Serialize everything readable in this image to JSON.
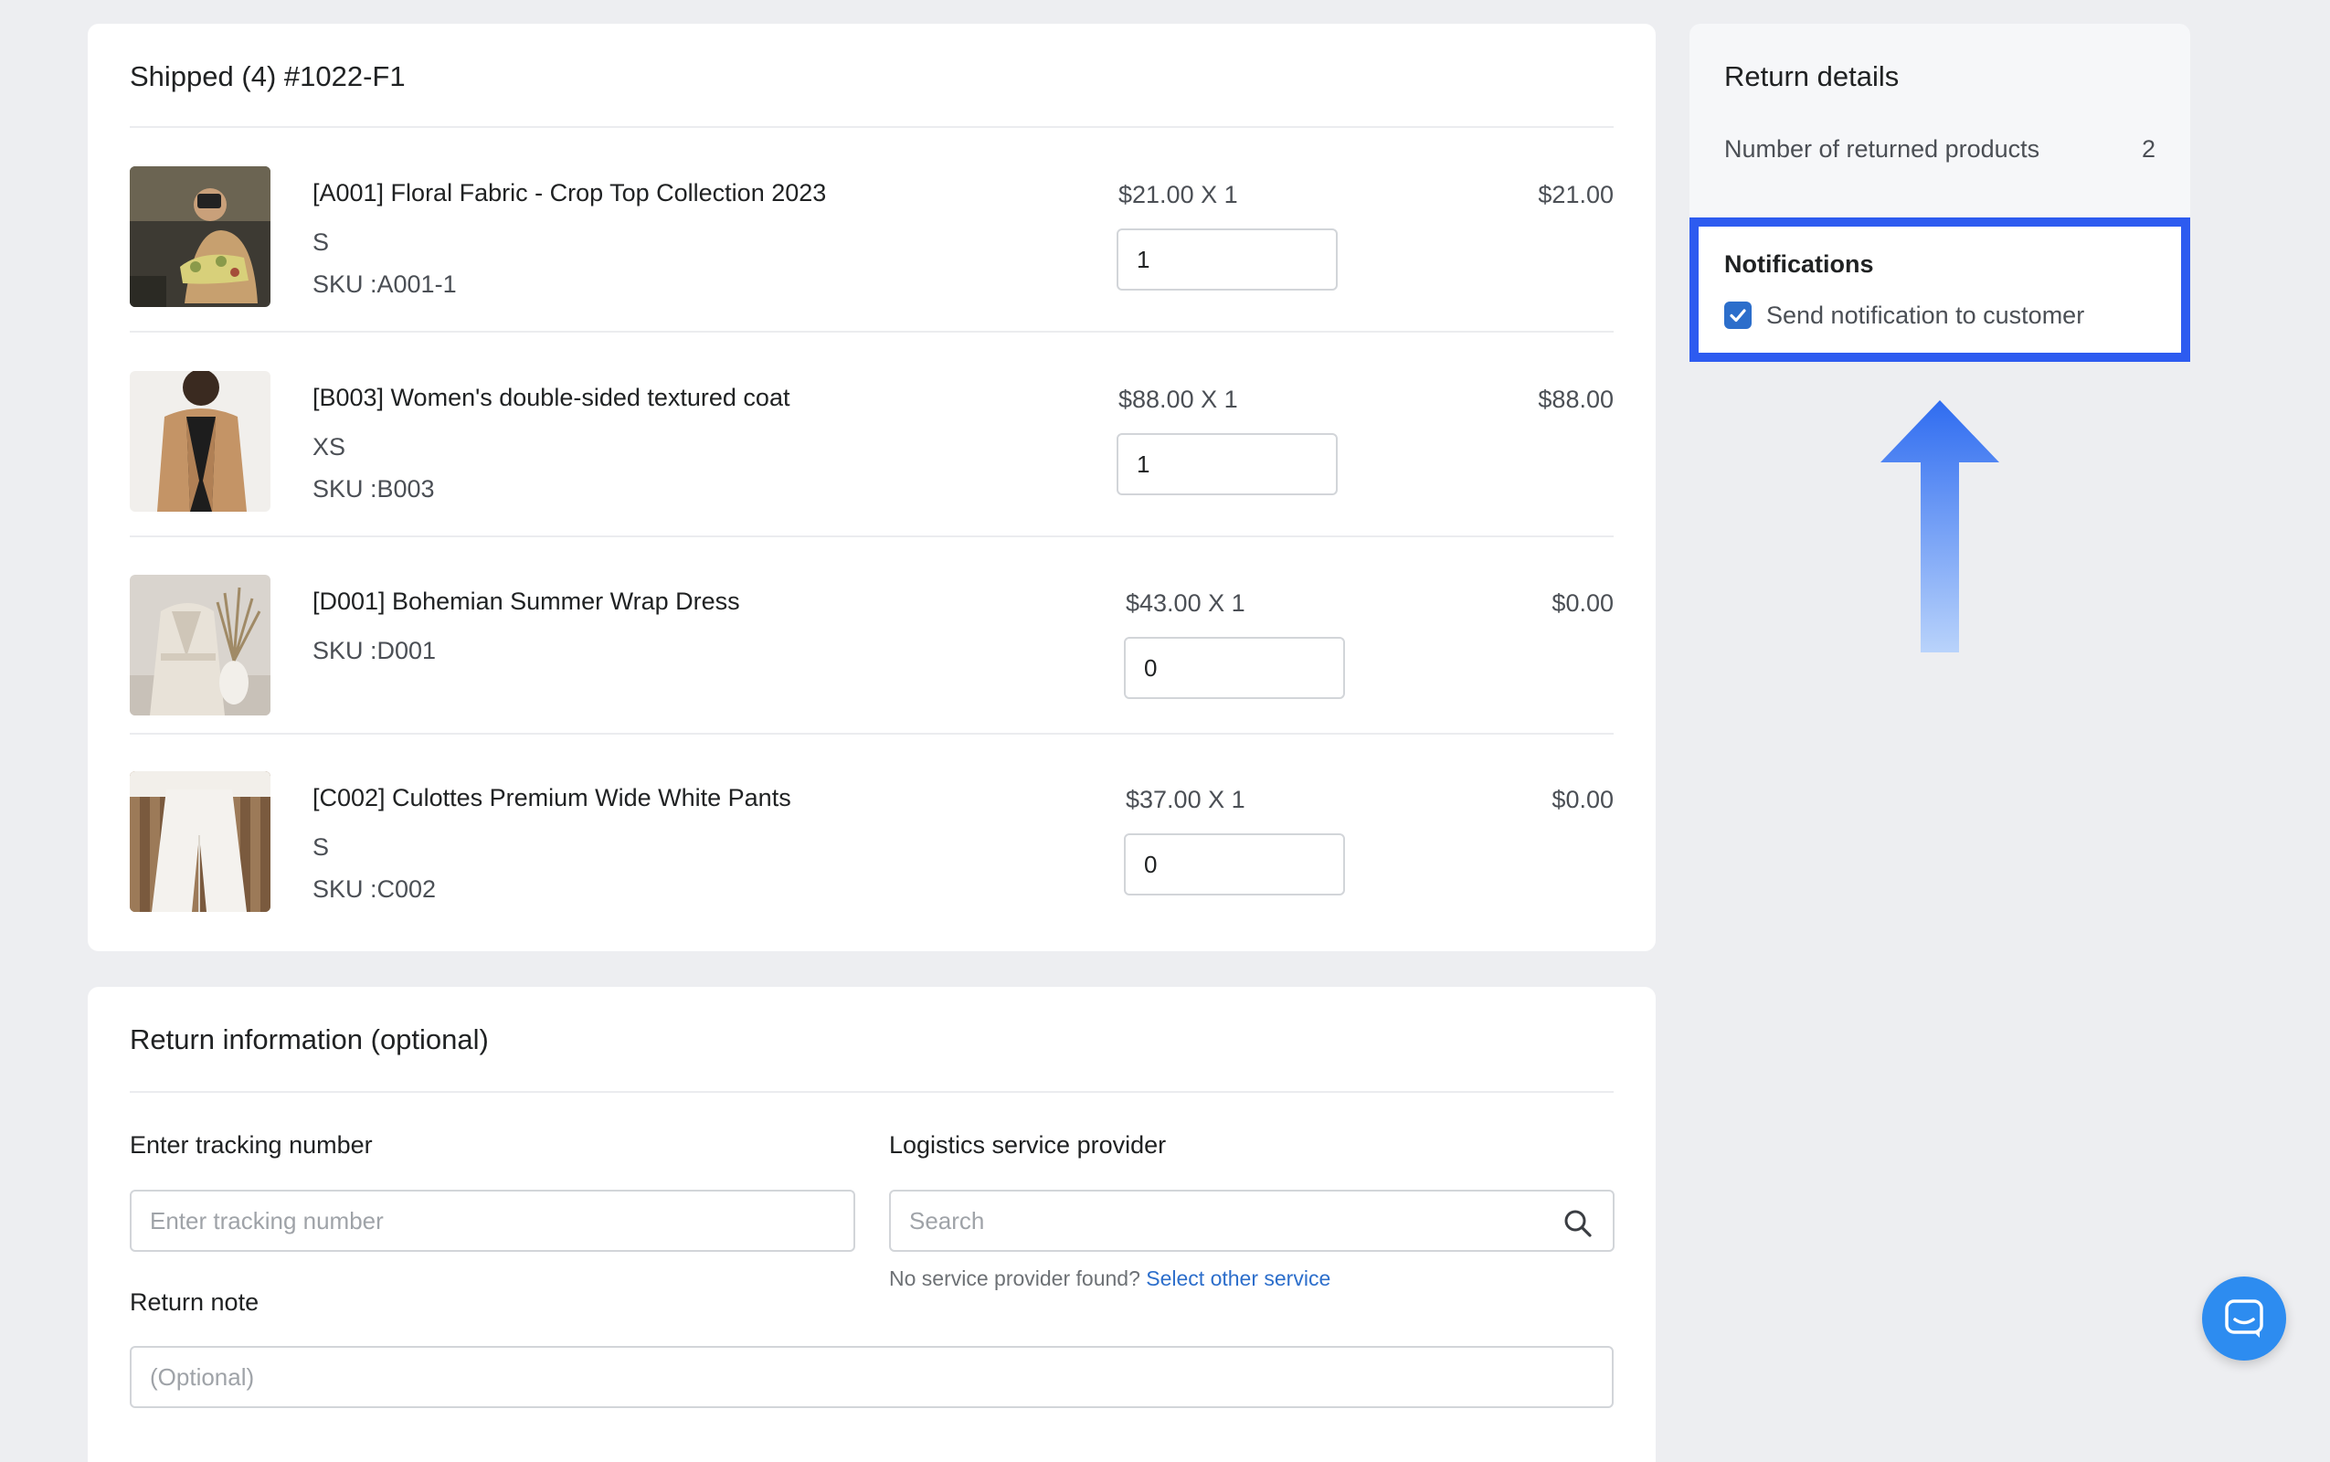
{
  "shipment": {
    "title": "Shipped (4) #1022-F1",
    "items": [
      {
        "name": "[A001] Floral Fabric - Crop Top Collection 2023",
        "variant": "S",
        "sku": "SKU :A001-1",
        "unit_price": "$21.00 X 1",
        "quantity": "1",
        "total": "$21.00",
        "image_icon": "floral-crop-top-photo"
      },
      {
        "name": "[B003] Women's double-sided textured coat",
        "variant": "XS",
        "sku": "SKU :B003",
        "unit_price": "$88.00 X 1",
        "quantity": "1",
        "total": "$88.00",
        "image_icon": "camel-coat-photo"
      },
      {
        "name": "[D001] Bohemian Summer Wrap Dress",
        "sku": "SKU :D001",
        "unit_price": "$43.00 X 1",
        "quantity": "0",
        "total": "$0.00",
        "image_icon": "wrap-dress-photo"
      },
      {
        "name": "[C002] Culottes Premium Wide White Pants",
        "variant": "S",
        "sku": "SKU :C002",
        "unit_price": "$37.00 X 1",
        "quantity": "0",
        "total": "$0.00",
        "image_icon": "white-pants-photo"
      }
    ]
  },
  "return_info": {
    "title": "Return information (optional)",
    "tracking_label": "Enter tracking number",
    "tracking_placeholder": "Enter tracking number",
    "logistics_label": "Logistics service provider",
    "logistics_placeholder": "Search",
    "helper_text": "No service provider found?",
    "helper_link": "Select other service",
    "note_label": "Return note",
    "note_placeholder": "(Optional)"
  },
  "return_details": {
    "title": "Return details",
    "returned_products_label": "Number of returned products",
    "returned_products_value": "2"
  },
  "notifications": {
    "title": "Notifications",
    "send_label": "Send notification to customer",
    "checked": true
  },
  "colors": {
    "accent_blue": "#2c6ecb",
    "highlight_border": "#2d5bf0",
    "chat_button": "#2d8cf0"
  },
  "icons": {
    "search": "search-icon",
    "checkbox": "checkmark-icon",
    "chat": "chat-icon",
    "annotation": "up-arrow-icon"
  }
}
